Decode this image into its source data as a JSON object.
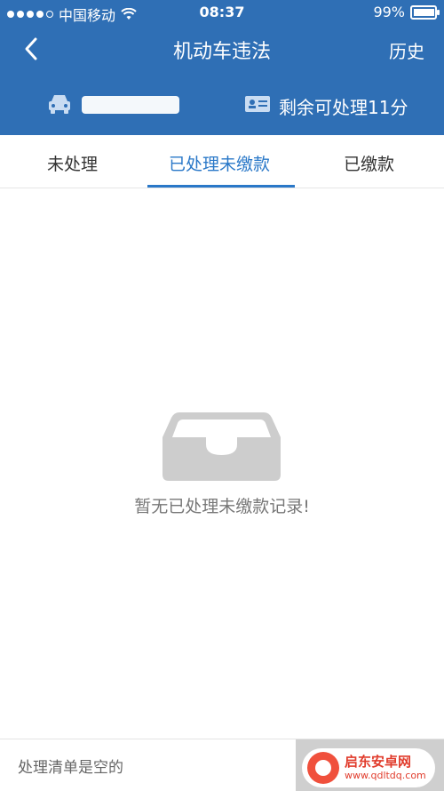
{
  "status": {
    "carrier": "中国移动",
    "time": "08:37",
    "battery": "99%"
  },
  "nav": {
    "title": "机动车违法",
    "history_label": "历史"
  },
  "info": {
    "remain": "剩余可处理11分"
  },
  "tabs": [
    {
      "label": "未处理",
      "active": false
    },
    {
      "label": "已处理未缴款",
      "active": true
    },
    {
      "label": "已缴款",
      "active": false
    }
  ],
  "empty": {
    "message": "暂无已处理未缴款记录!"
  },
  "bottom": {
    "text": "处理清单是空的"
  },
  "watermark": {
    "title": "启东安卓网",
    "url": "www.qdltdq.com"
  },
  "colors": {
    "header": "#2f6fb5",
    "accent": "#2a78c8"
  }
}
